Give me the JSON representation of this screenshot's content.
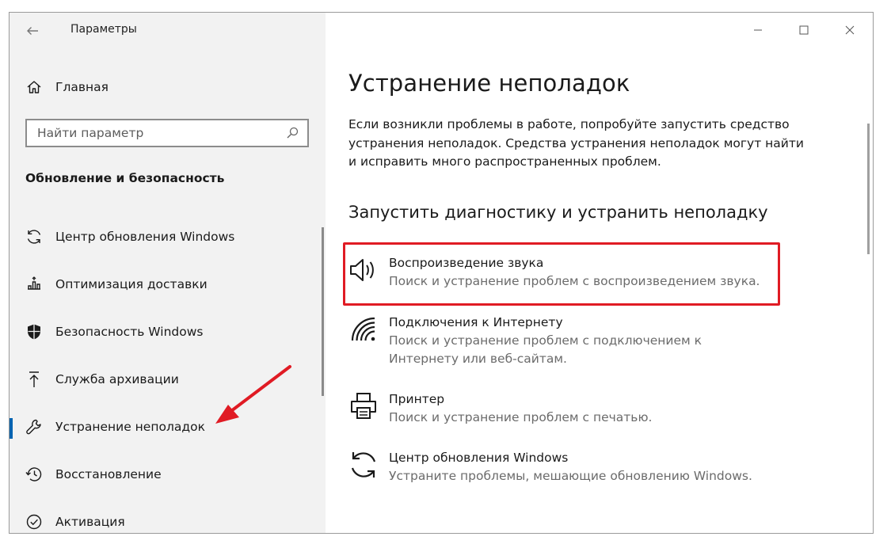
{
  "window": {
    "app_title": "Параметры",
    "controls": [
      "minimize-icon",
      "maximize-icon",
      "close-icon"
    ]
  },
  "sidebar": {
    "home_label": "Главная",
    "search_placeholder": "Найти параметр",
    "section_title": "Обновление и безопасность",
    "items": [
      {
        "label": "Центр обновления Windows",
        "icon": "sync-icon",
        "active": false
      },
      {
        "label": "Оптимизация доставки",
        "icon": "delivery-optimization-icon",
        "active": false
      },
      {
        "label": "Безопасность Windows",
        "icon": "shield-icon",
        "active": false
      },
      {
        "label": "Служба архивации",
        "icon": "backup-arrow-icon",
        "active": false
      },
      {
        "label": "Устранение неполадок",
        "icon": "wrench-icon",
        "active": true
      },
      {
        "label": "Восстановление",
        "icon": "history-icon",
        "active": false
      },
      {
        "label": "Активация",
        "icon": "check-circle-icon",
        "active": false
      }
    ]
  },
  "main": {
    "title": "Устранение неполадок",
    "intro": "Если возникли проблемы в работе, попробуйте запустить средство устранения неполадок. Средства устранения неполадок могут найти и исправить много распространенных проблем.",
    "section_title": "Запустить диагностику и устранить неполадку",
    "troubleshooters": [
      {
        "title": "Воспроизведение звука",
        "desc": "Поиск и устранение проблем с воспроизведением звука.",
        "icon": "speaker-icon"
      },
      {
        "title": "Подключения к Интернету",
        "desc": "Поиск и устранение проблем с подключением к Интернету или веб-сайтам.",
        "icon": "wifi-icon"
      },
      {
        "title": "Принтер",
        "desc": "Поиск и устранение проблем с печатью.",
        "icon": "printer-icon"
      },
      {
        "title": "Центр обновления Windows",
        "desc": "Устраните проблемы, мешающие обновлению Windows.",
        "icon": "sync-icon"
      }
    ]
  },
  "colors": {
    "accent": "#0063b1",
    "highlight": "#e01b24",
    "sidebar_bg": "#f2f2f2"
  }
}
